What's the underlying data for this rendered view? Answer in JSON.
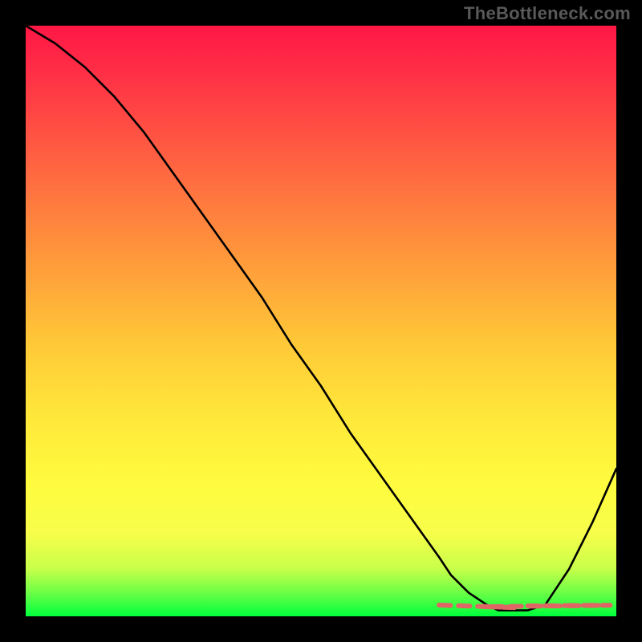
{
  "watermark": "TheBottleneck.com",
  "colors": {
    "background": "#000000",
    "gradient_top": "#ff1745",
    "gradient_bottom": "#00ff3c",
    "curve": "#000000",
    "highlight": "#e06666"
  },
  "chart_data": {
    "type": "line",
    "title": "",
    "xlabel": "",
    "ylabel": "",
    "xlim": [
      0,
      100
    ],
    "ylim": [
      0,
      100
    ],
    "grid": false,
    "legend": false,
    "series": [
      {
        "name": "bottleneck-curve",
        "x": [
          0,
          5,
          10,
          15,
          20,
          25,
          30,
          35,
          40,
          45,
          50,
          55,
          60,
          65,
          70,
          72,
          75,
          78,
          80,
          82,
          85,
          88,
          92,
          96,
          100
        ],
        "values": [
          100,
          97,
          93,
          88,
          82,
          75,
          68,
          61,
          54,
          46,
          39,
          31,
          24,
          17,
          10,
          7,
          4,
          2,
          1,
          1,
          1,
          2,
          8,
          16,
          25
        ]
      }
    ],
    "annotations": [
      {
        "name": "optimal-zone-highlight",
        "x_start": 70,
        "x_end": 85,
        "y": 1,
        "style": "dashed",
        "color": "#e06666"
      }
    ]
  }
}
